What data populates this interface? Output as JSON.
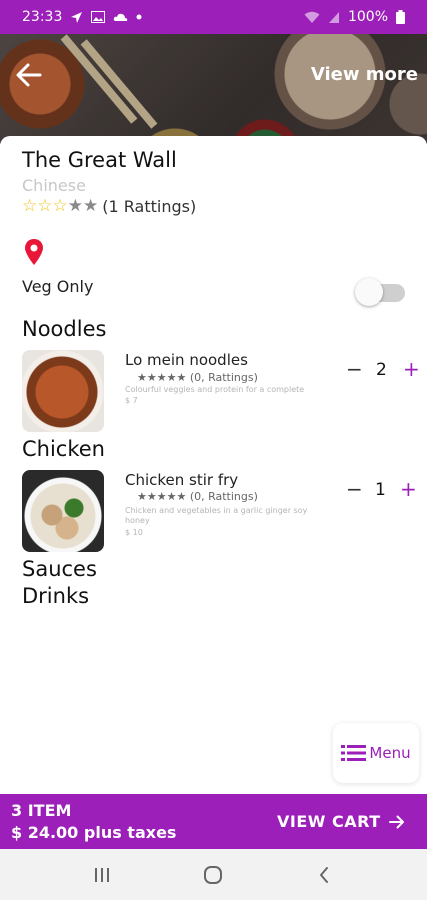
{
  "status_bar": {
    "time": "23:33",
    "battery": "100%",
    "icons": [
      "navigation-icon",
      "gallery-icon",
      "cloud-icon",
      "dot-icon",
      "wifi-icon",
      "signal-icon",
      "battery-icon"
    ]
  },
  "header": {
    "view_more": "View more",
    "back_icon": "arrow-left-icon"
  },
  "restaurant": {
    "name": "The Great Wall",
    "cuisine": "Chinese",
    "rating_stars": 3,
    "rating_max": 5,
    "rating_text": "(1 Rattings)"
  },
  "filters": {
    "veg_only_label": "Veg Only",
    "veg_only_enabled": false
  },
  "sections": [
    {
      "title": "Noodles",
      "items": [
        {
          "name": "Lo mein noodles",
          "stars": "★★★★★",
          "ratings": "(0, Rattings)",
          "description": "Colourful veggies and protein for a complete",
          "price": "$ 7",
          "quantity": "2"
        }
      ]
    },
    {
      "title": "Chicken",
      "items": [
        {
          "name": "Chicken stir fry",
          "stars": "★★★★★",
          "ratings": "(0, Rattings)",
          "description": "Chicken and vegetables in a garlic ginger soy honey",
          "price": "$ 10",
          "quantity": "1"
        }
      ]
    },
    {
      "title": "Sauces",
      "items": []
    },
    {
      "title": "Drinks",
      "items": []
    }
  ],
  "qty_controls": {
    "minus": "−",
    "plus": "+"
  },
  "menu_button": {
    "label": "Menu",
    "icon": "list-icon"
  },
  "cart_bar": {
    "item_count": "3 ITEM",
    "total": "$ 24.00 plus taxes",
    "view_cart_label": "VIEW CART",
    "arrow_icon": "arrow-right-icon"
  },
  "colors": {
    "brand": "#9b1fb8",
    "star_active": "#f2c21b",
    "star_inactive": "#8a8a8a",
    "pin": "#e8173a"
  }
}
